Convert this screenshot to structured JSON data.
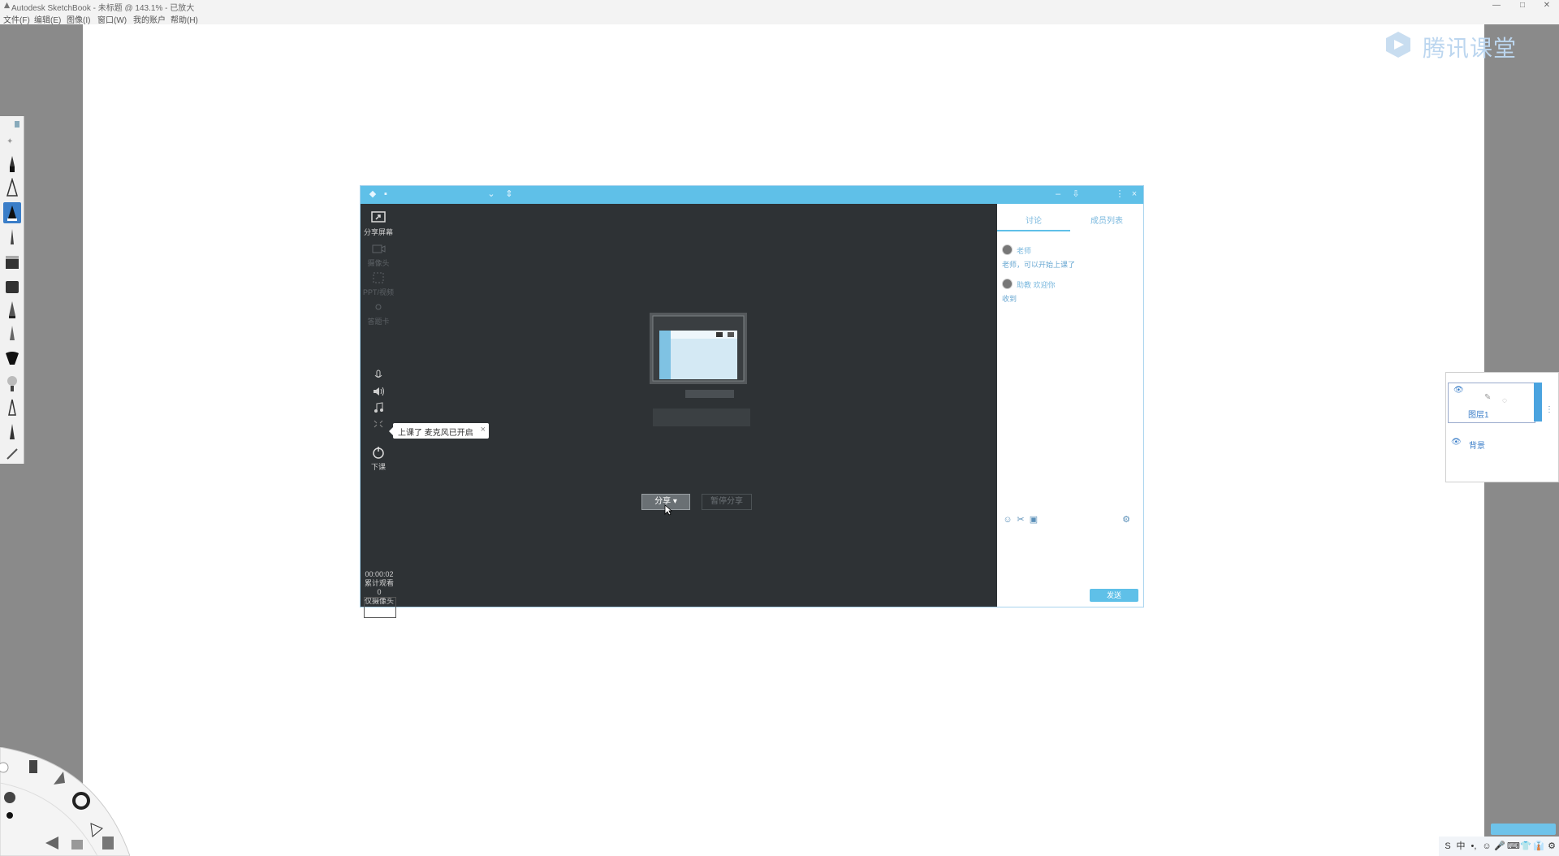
{
  "app": {
    "title": "Autodesk SketchBook - 未标题 @ 143.1% - 已放大",
    "window_controls": [
      "—",
      "□",
      "✕"
    ],
    "menus": [
      "文件(F)",
      "编辑(E)",
      "图像(I)",
      "窗口(W)",
      "我的账户",
      "帮助(H)"
    ]
  },
  "brand": {
    "text": "腾讯课堂",
    "color": "#bcd6ef"
  },
  "classroom": {
    "titlebar_icons": [
      "back-icon",
      "home-icon",
      "dropdown-icon",
      "expand-icon",
      "minimize-icon",
      "pin-icon",
      "more-icon",
      "close-icon"
    ],
    "side": {
      "share_screen": "分享屏幕",
      "camera": "摄像头",
      "ppt": "PPT/视频",
      "question": "答题卡",
      "end_class": "下课"
    },
    "mic_toast": "上课了 麦克风已开启",
    "timer": {
      "elapsed": "00:00:02",
      "stat_label": "累计观看",
      "stat_value": "0",
      "cam_label": "仅摄像头"
    },
    "buttons": {
      "start": "分享 ▾",
      "other": "暂停分享"
    },
    "chat": {
      "tab_discussion": "讨论",
      "tab_members": "成员列表",
      "messages": [
        {
          "who": "老师",
          "body": "老师，可以开始上课了"
        },
        {
          "who": "助教 欢迎你",
          "body": "收到"
        }
      ],
      "send": "发送"
    },
    "accent": "#5fc0e8"
  },
  "layers": {
    "layer1": "图层1",
    "background": "背景"
  },
  "tray": {
    "ime": "中",
    "items": [
      "S",
      "中",
      "•,",
      "☺",
      "🎤",
      "⌨",
      "👕",
      "👔",
      "⚙"
    ]
  }
}
